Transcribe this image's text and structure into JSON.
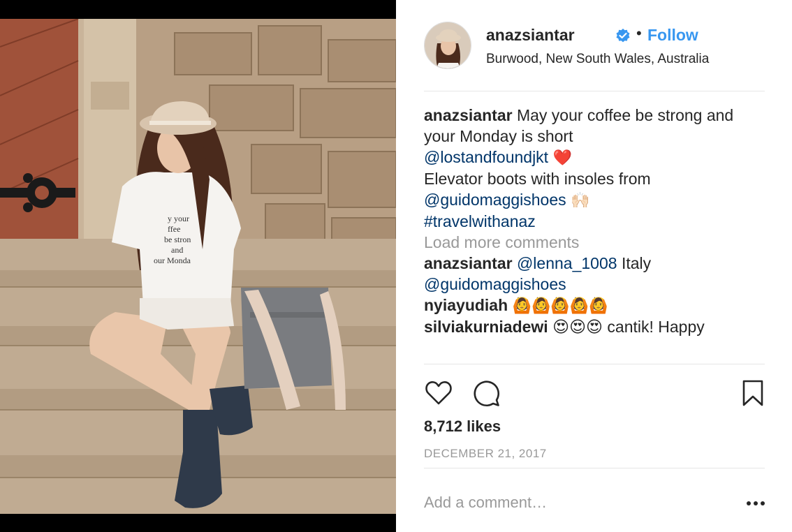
{
  "post": {
    "username": "anazsiantar",
    "follow_label": "Follow",
    "separator": "•",
    "location": "Burwood, New South Wales, Australia",
    "caption_username": "anazsiantar",
    "caption_line1": "May your coffee be strong and your Monday is short",
    "caption_mention1": "@lostandfoundjkt",
    "caption_heart": "❤️",
    "caption_line2": "Elevator boots with insoles from",
    "caption_mention2": "@guidomaggishoes",
    "caption_hands": "🙌🏻",
    "caption_hashtag": "#travelwithanaz",
    "load_more_label": "Load more comments",
    "comments": [
      {
        "username": "anazsiantar",
        "mention": "@lenna_1008",
        "text": "Italy",
        "mention2": "@guidomaggishoes"
      },
      {
        "username": "nyiayudiah",
        "text": "🙆🙆🙆🙆🙆"
      },
      {
        "username": "silviakurniadewi",
        "text": "😍😍😍 cantik! Happy"
      }
    ],
    "likes": "8,712 likes",
    "date": "DECEMBER 21, 2017",
    "add_comment_placeholder": "Add a comment…"
  },
  "icons": {
    "verified": "verified-badge-icon",
    "like": "heart-icon",
    "comment": "comment-bubble-icon",
    "save": "bookmark-icon",
    "more": "more-options-icon"
  },
  "colors": {
    "link_blue": "#3897f0",
    "mention_blue": "#003569",
    "muted_gray": "#999999",
    "divider": "#e6e6e6"
  }
}
